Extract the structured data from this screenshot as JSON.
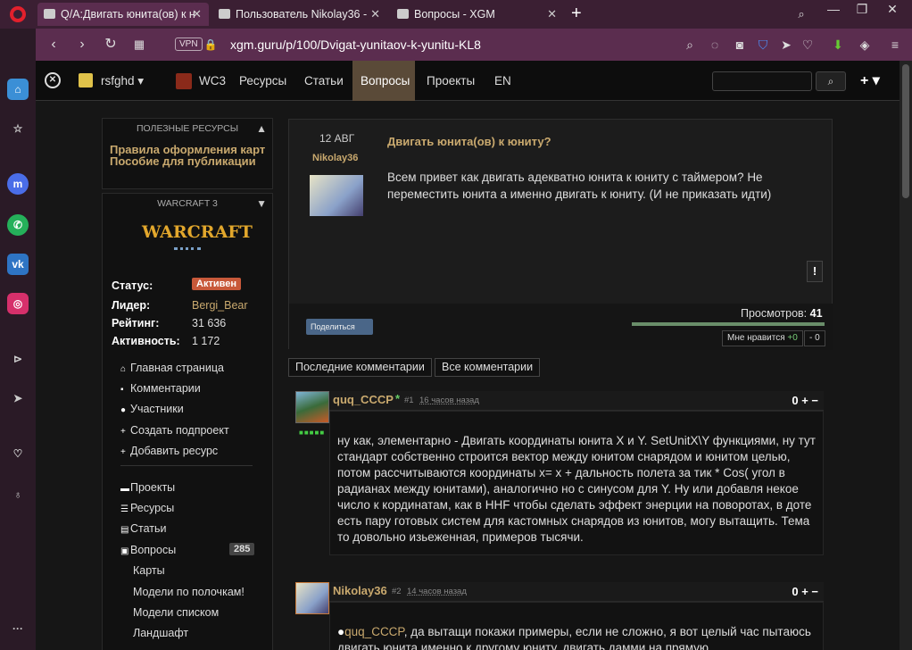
{
  "browser": {
    "tabs": [
      {
        "title": "Q/A:Двигать юнита(ов) к н",
        "close": "✕"
      },
      {
        "title": "Пользователь Nikolay36 -",
        "close": "✕"
      },
      {
        "title": "Вопросы - XGM",
        "close": "✕"
      }
    ],
    "new_tab": "+",
    "vpn": "VPN",
    "url": "xgm.guru/p/100/Dvigat-yunitaov-k-yunitu-KL8"
  },
  "site_nav": {
    "user": "rsfghd",
    "items": [
      "WC3",
      "Ресурсы",
      "Статьи",
      "Вопросы",
      "Проекты",
      "EN"
    ],
    "active": "Вопросы"
  },
  "left": {
    "useful_title": "ПОЛЕЗНЫЕ РЕСУРСЫ",
    "useful_links": [
      "Правила оформления карт",
      "Пособие для публикации"
    ],
    "wc_title": "WARCRAFT 3",
    "logo_text": "WARCRAFT",
    "stats": [
      {
        "label": "Статус:",
        "value": "Активен"
      },
      {
        "label": "Лидер:",
        "value": "Bergi_Bear"
      },
      {
        "label": "Рейтинг:",
        "value": "31 636"
      },
      {
        "label": "Активность:",
        "value": "1 172"
      }
    ],
    "menu1": [
      "Главная страница",
      "Комментарии",
      "Участники",
      "Создать подпроект",
      "Добавить ресурс"
    ],
    "menu2": [
      "Проекты",
      "Ресурсы",
      "Статьи",
      "Вопросы",
      "Карты",
      "Модели по полочкам!",
      "Модели списком",
      "Ландшафт"
    ],
    "questions_count": "285"
  },
  "question": {
    "date": "12 АВГ",
    "author": "Nikolay36",
    "title": "Двигать юнита(ов) к юниту?",
    "text": "Всем привет как двигать адекватно юнита к юниту с таймером? Не переместить юнита а именно двигать к юниту. (И не приказать идти)",
    "flag": "!",
    "share": "Поделиться",
    "views_label": "Просмотров:",
    "views": "41",
    "like_label": "Мне нравится",
    "like_count": "+0",
    "dislike": "- 0"
  },
  "comment_buttons": [
    "Последние комментарии",
    "Все комментарии"
  ],
  "comments": [
    {
      "author": "quq_CCCP",
      "star": "*",
      "num": "#1",
      "time": "16 часов назад",
      "score": "0",
      "text": "ну как, элементарно - Двигать координаты юнита X и Y. SetUnitX\\Y функциями, ну тут стандарт собственно строится вектор между юнитом снарядом и юнитом целью, потом рассчитываются координаты x= x + дальность полета за тик * Cos( угол в радианах между юнитами), аналогично но с синусом для Y. Ну или добавля некое число к кординатам, как в HHF чтобы сделать эффект энерции на поворотах, в доте есть пару готовых систем для кастомных снарядов из юнитов, могу вытащить. Тема то довольно изьеженная, примеров тысячи."
    },
    {
      "author": "Nikolay36",
      "num": "#2",
      "time": "14 часов назад",
      "score": "0",
      "mention": "quq_CCCP",
      "text": ", да вытащи покажи примеры, если не сложно, я вот целый час пытаюсь двигать юнита именно к другому юниту, двигать дамми на прямую"
    }
  ]
}
